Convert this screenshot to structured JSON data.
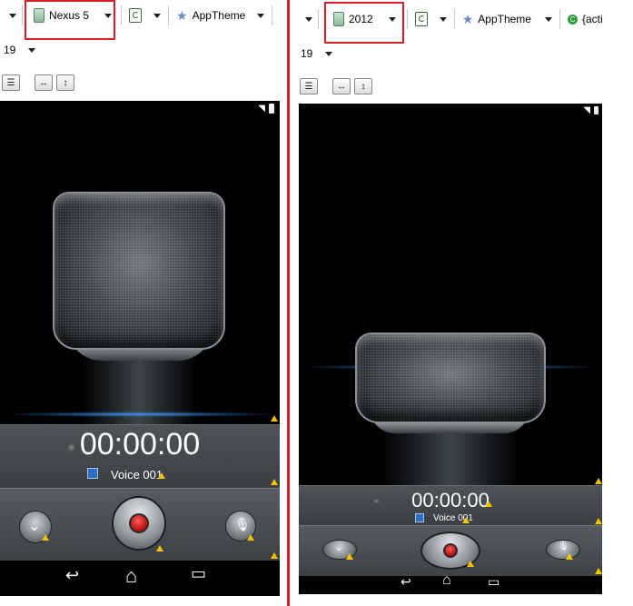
{
  "left": {
    "device_label": "Nexus 5",
    "theme_label": "AppTheme",
    "api_level": "19",
    "recording_time": "00:00:00",
    "file_name": "Voice 001"
  },
  "right": {
    "device_label": "2012",
    "theme_label": "AppTheme",
    "activity_label": "{acti",
    "api_level": "19",
    "recording_time": "00:00:00",
    "file_name": "Voice 001"
  },
  "colors": {
    "highlight": "#d61f26",
    "record_dot": "#c61212",
    "screen_bg": "#000000",
    "panel_bg": "#4a4f53"
  },
  "icons": {
    "nav_back": "↩",
    "nav_home": "⌂",
    "nav_recents": "▭",
    "wifi": "wifi-icon",
    "battery": "battery-icon"
  }
}
